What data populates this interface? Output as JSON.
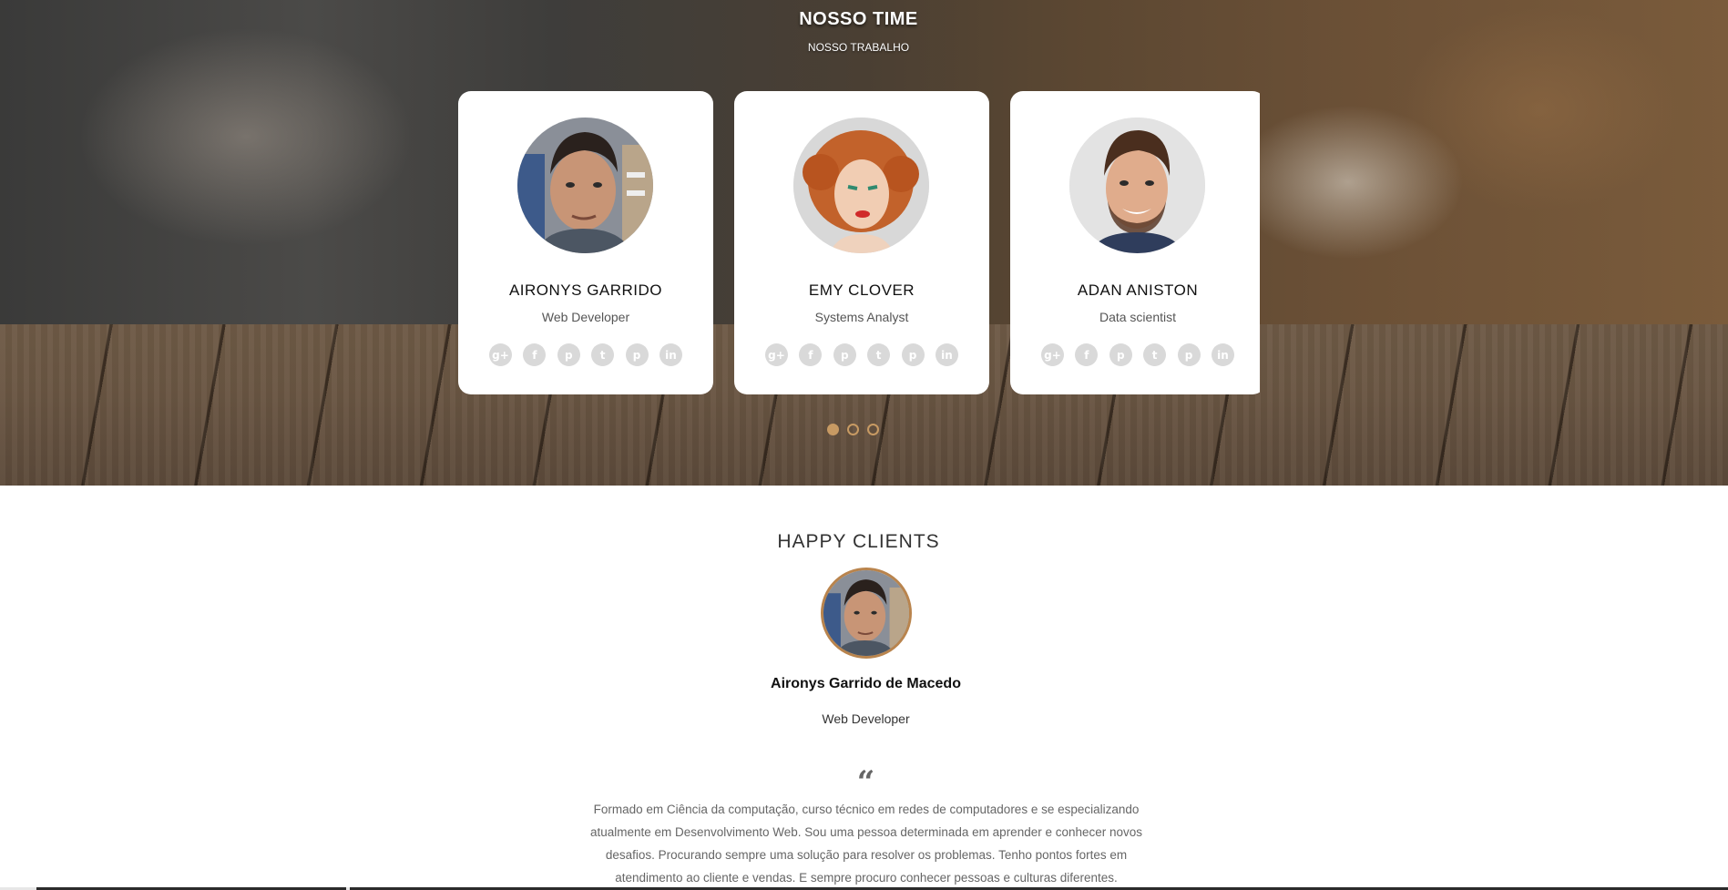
{
  "team": {
    "title": "NOSSO TIME",
    "subtitle": "NOSSO TRABALHO",
    "members": [
      {
        "name": "AIRONYS GARRIDO",
        "role": "Web Developer",
        "photo": "man-dark-hair-photo"
      },
      {
        "name": "EMY CLOVER",
        "role": "Systems Analyst",
        "photo": "woman-red-hair-photo"
      },
      {
        "name": "ADAN ANISTON",
        "role": "Data scientist",
        "photo": "man-smiling-beard-photo"
      }
    ],
    "social_icons": [
      "google-plus-icon",
      "facebook-icon",
      "pinterest-icon",
      "twitter-icon",
      "pinterest-icon",
      "linkedin-icon"
    ],
    "carousel": {
      "pages": 3,
      "active_page": 1
    }
  },
  "clients": {
    "title": "HAPPY CLIENTS",
    "client_name": "Aironys Garrido de Macedo",
    "client_role": "Web Developer",
    "quote_mark": "“",
    "quote_lines": [
      "Formado em Ciência da computação, curso técnico em redes de computadores e se especializando",
      "atualmente em Desenvolvimento Web. Sou uma pessoa determinada em aprender e conhecer novos",
      "desafios. Procurando sempre uma solução para resolver os problemas. Tenho pontos fortes em",
      "atendimento ao cliente e vendas. E sempre procuro conhecer pessoas e culturas diferentes."
    ]
  },
  "colors": {
    "accent": "#c79a63",
    "avatar_border": "#b9844d",
    "social_icon_bg": "#d9d9d9"
  }
}
